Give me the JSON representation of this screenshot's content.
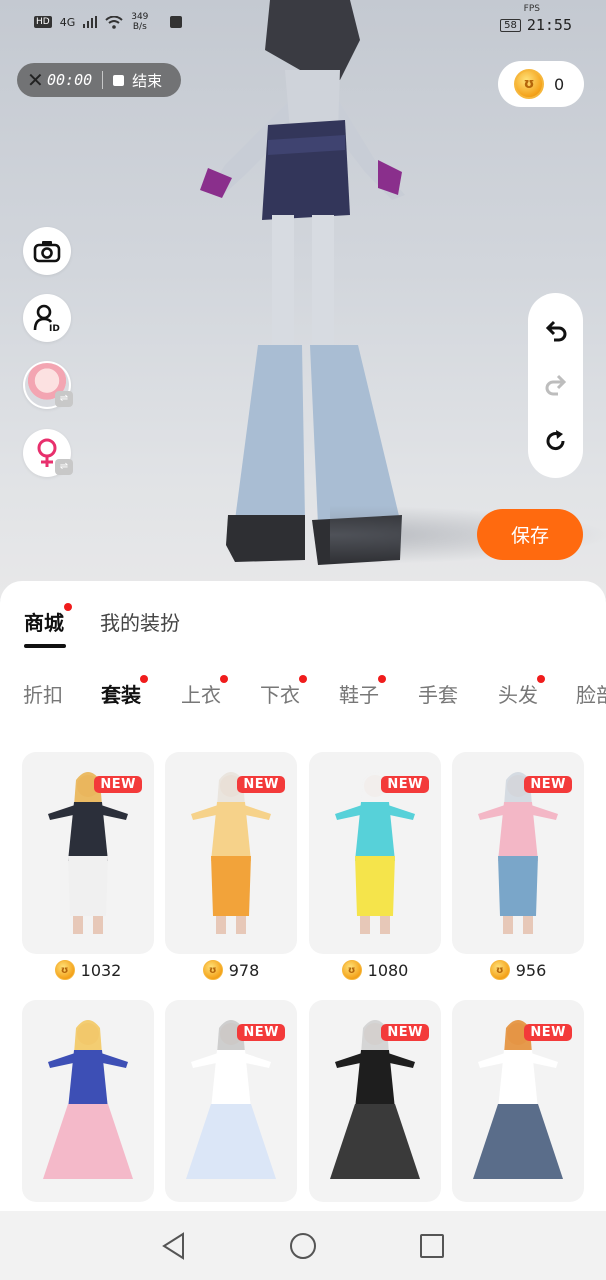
{
  "status_bar": {
    "hd": "HD",
    "network": "4G",
    "speed_value": "349",
    "speed_unit": "B/s",
    "fps_label": "FPS",
    "battery": "58",
    "clock": "21:55"
  },
  "recording": {
    "time": "00:00",
    "stop_label": "结束"
  },
  "coins": {
    "balance": "0"
  },
  "left_tools": [
    {
      "icon": "camera-icon"
    },
    {
      "icon": "profile-id-icon"
    },
    {
      "icon": "avatar-swap"
    },
    {
      "icon": "female-gender-icon"
    }
  ],
  "history_controls": [
    "undo-icon",
    "redo-icon",
    "reset-icon"
  ],
  "save_label": "保存",
  "main_tabs": [
    {
      "label": "商城",
      "active": true,
      "dot": true
    },
    {
      "label": "我的装扮",
      "active": false,
      "dot": false
    }
  ],
  "categories": [
    {
      "label": "折扣",
      "active": false,
      "dot": false
    },
    {
      "label": "套装",
      "active": true,
      "dot": true
    },
    {
      "label": "上衣",
      "active": false,
      "dot": true
    },
    {
      "label": "下衣",
      "active": false,
      "dot": true
    },
    {
      "label": "鞋子",
      "active": false,
      "dot": true
    },
    {
      "label": "手套",
      "active": false,
      "dot": false
    },
    {
      "label": "头发",
      "active": false,
      "dot": true
    },
    {
      "label": "脸部",
      "active": false,
      "dot": false
    }
  ],
  "new_badge": "NEW",
  "items": [
    {
      "price": "1032",
      "is_new": true,
      "colors": [
        "#2b2f3a",
        "#f0f0f0",
        "#e9b04a"
      ]
    },
    {
      "price": "978",
      "is_new": true,
      "colors": [
        "#f6d28a",
        "#f2a33a",
        "#e7e2d9"
      ]
    },
    {
      "price": "1080",
      "is_new": true,
      "colors": [
        "#57d1d9",
        "#f5e44b",
        "#f2f2f2"
      ]
    },
    {
      "price": "956",
      "is_new": true,
      "colors": [
        "#f3b7c6",
        "#7aa6c9",
        "#cfd6de"
      ]
    },
    {
      "price": "",
      "is_new": false,
      "colors": [
        "#3d4fb5",
        "#f4b9c9",
        "#f2c55a"
      ]
    },
    {
      "price": "",
      "is_new": true,
      "colors": [
        "#ffffff",
        "#dbe6f7",
        "#c7c7c7"
      ]
    },
    {
      "price": "",
      "is_new": true,
      "colors": [
        "#1e1e1e",
        "#3a3a3a",
        "#cfcfcf"
      ]
    },
    {
      "price": "",
      "is_new": true,
      "colors": [
        "#ffffff",
        "#5a6d8a",
        "#e38a2e"
      ]
    }
  ],
  "accent_color": "#ff6a0f"
}
